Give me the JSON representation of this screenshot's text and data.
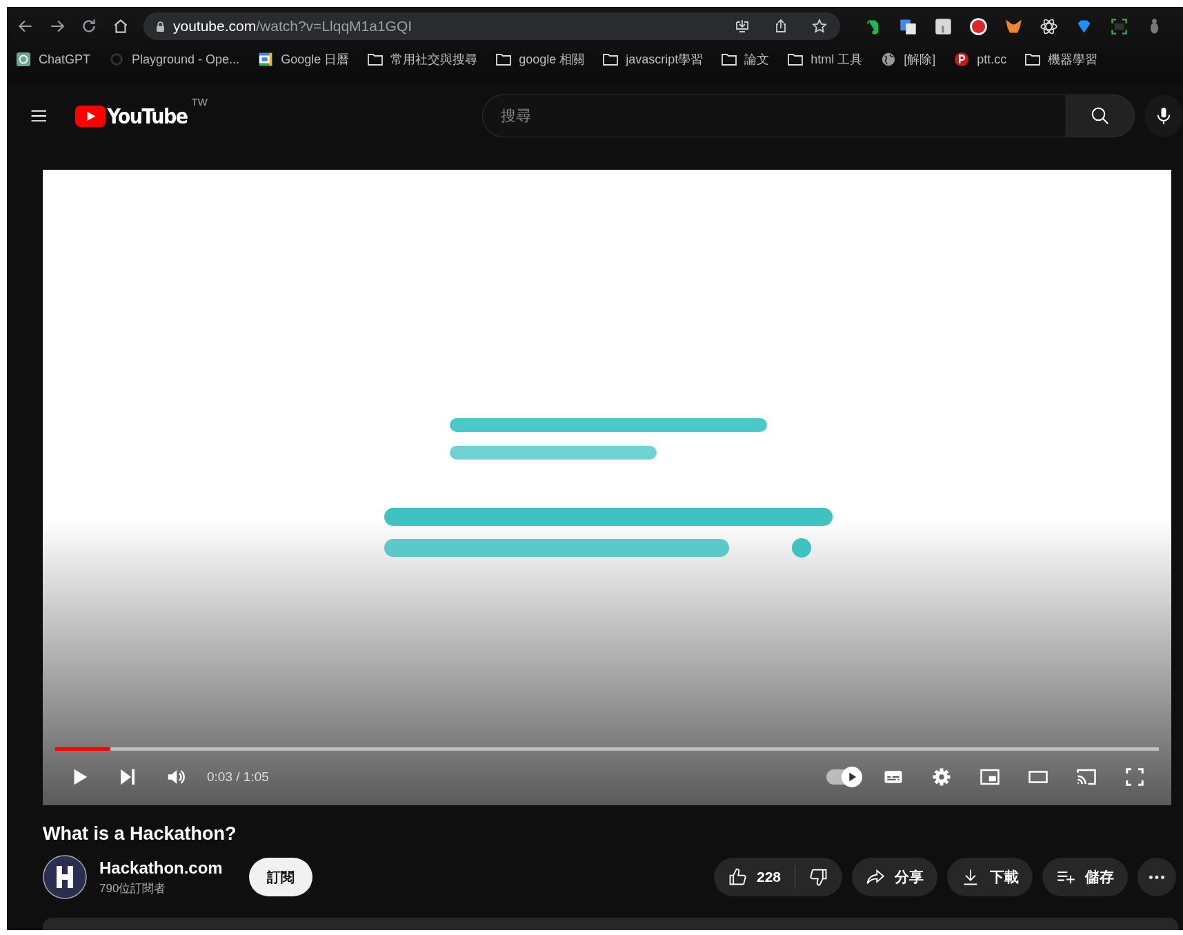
{
  "browser": {
    "url_host": "youtube.com",
    "url_path": "/watch?v=LlqqM1a1GQI",
    "bookmarks": [
      {
        "kind": "chatgpt",
        "label": "ChatGPT"
      },
      {
        "kind": "openai",
        "label": "Playground - Ope..."
      },
      {
        "kind": "calendar",
        "label": "Google 日曆"
      },
      {
        "kind": "folder",
        "label": "常用社交與搜尋"
      },
      {
        "kind": "folder",
        "label": "google 相關"
      },
      {
        "kind": "folder",
        "label": "javascript學習"
      },
      {
        "kind": "folder",
        "label": "論文"
      },
      {
        "kind": "folder",
        "label": "html 工具"
      },
      {
        "kind": "globe",
        "label": "[解除]"
      },
      {
        "kind": "ptt",
        "label": "ptt.cc"
      },
      {
        "kind": "folder",
        "label": "機器學習"
      }
    ]
  },
  "masthead": {
    "logo_text": "YouTube",
    "region": "TW",
    "search": {
      "placeholder": "搜尋"
    }
  },
  "player": {
    "progress": {
      "level": 0.05
    },
    "time": "0:03 / 1:05",
    "autoplay": {
      "on": true
    }
  },
  "video": {
    "title": "What is a Hackathon?",
    "channel": {
      "name": "Hackathon.com",
      "subscribers": "790位訂閱者"
    },
    "subscribe": "訂閱",
    "actions": {
      "likes": "228",
      "share": "分享",
      "download": "下載",
      "save": "儲存"
    }
  }
}
